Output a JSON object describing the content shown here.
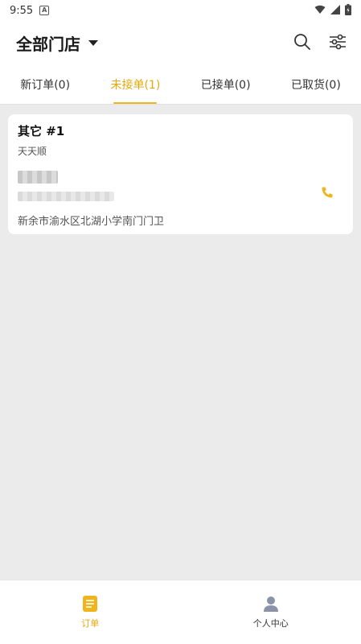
{
  "status_bar": {
    "time": "9:55",
    "notification_badge": "A"
  },
  "header": {
    "store_title": "全部门店"
  },
  "tabs": [
    {
      "label": "新订单(0)",
      "active": false
    },
    {
      "label": "未接单(1)",
      "active": true
    },
    {
      "label": "已接单(0)",
      "active": false
    },
    {
      "label": "已取货(0)",
      "active": false
    }
  ],
  "order": {
    "title": "其它 #1",
    "store": "天天顺",
    "address": "新余市渝水区北湖小学南门门卫"
  },
  "bottom_nav": [
    {
      "label": "订单",
      "icon": "orders-icon",
      "active": true
    },
    {
      "label": "个人中心",
      "icon": "profile-icon",
      "active": false
    }
  ],
  "colors": {
    "accent": "#f0b51c",
    "accent_text": "#e5a80f",
    "background": "#ebebeb"
  }
}
